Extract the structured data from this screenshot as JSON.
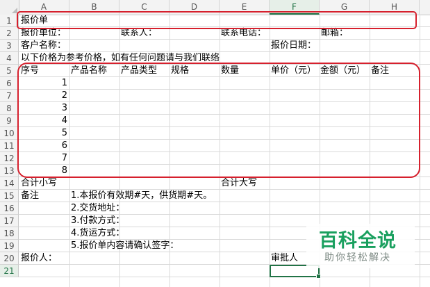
{
  "columns": [
    "A",
    "B",
    "C",
    "D",
    "E",
    "F",
    "G",
    "H"
  ],
  "rows": [
    "1",
    "2",
    "3",
    "4",
    "5",
    "6",
    "7",
    "8",
    "9",
    "10",
    "11",
    "12",
    "13",
    "14",
    "15",
    "16",
    "17",
    "18",
    "19",
    "20",
    "21"
  ],
  "active_column": "F",
  "active_row": "21",
  "cells": {
    "a1": "报价单",
    "a2": "报价单位：",
    "c2": "联系人：",
    "e2": "联系电话：",
    "g2": "邮箱：",
    "a3": "客户名称：",
    "f3": "报价日期：",
    "a4": "以下价格为参考价格，如有任何问题请与我们联络",
    "header": {
      "seq": "序号",
      "product_name": "产品名称",
      "product_type": "产品类型",
      "spec": "规格",
      "qty": "数量",
      "unit_price": "单价（元）",
      "amount": "金额（元）",
      "remark": "备注"
    },
    "seq_numbers": [
      "1",
      "2",
      "3",
      "4",
      "5",
      "6",
      "7",
      "8"
    ],
    "a14": "合计小写",
    "e14": "合计大写",
    "a15": "备注",
    "notes": [
      "1.本报价有效期#天，供货期#天。",
      "2.交货地址：",
      "3.付款方式：",
      "4.货运方式：",
      "5.报价单内容请确认签字："
    ],
    "a20": "报价人：",
    "f20": "审批人"
  },
  "watermark": {
    "main": "百科全说",
    "sub": "助你轻松解决",
    "color": "#1aa05f"
  },
  "accent_colors": {
    "annotation_red": "#d6202d",
    "selection_green": "#217346"
  }
}
